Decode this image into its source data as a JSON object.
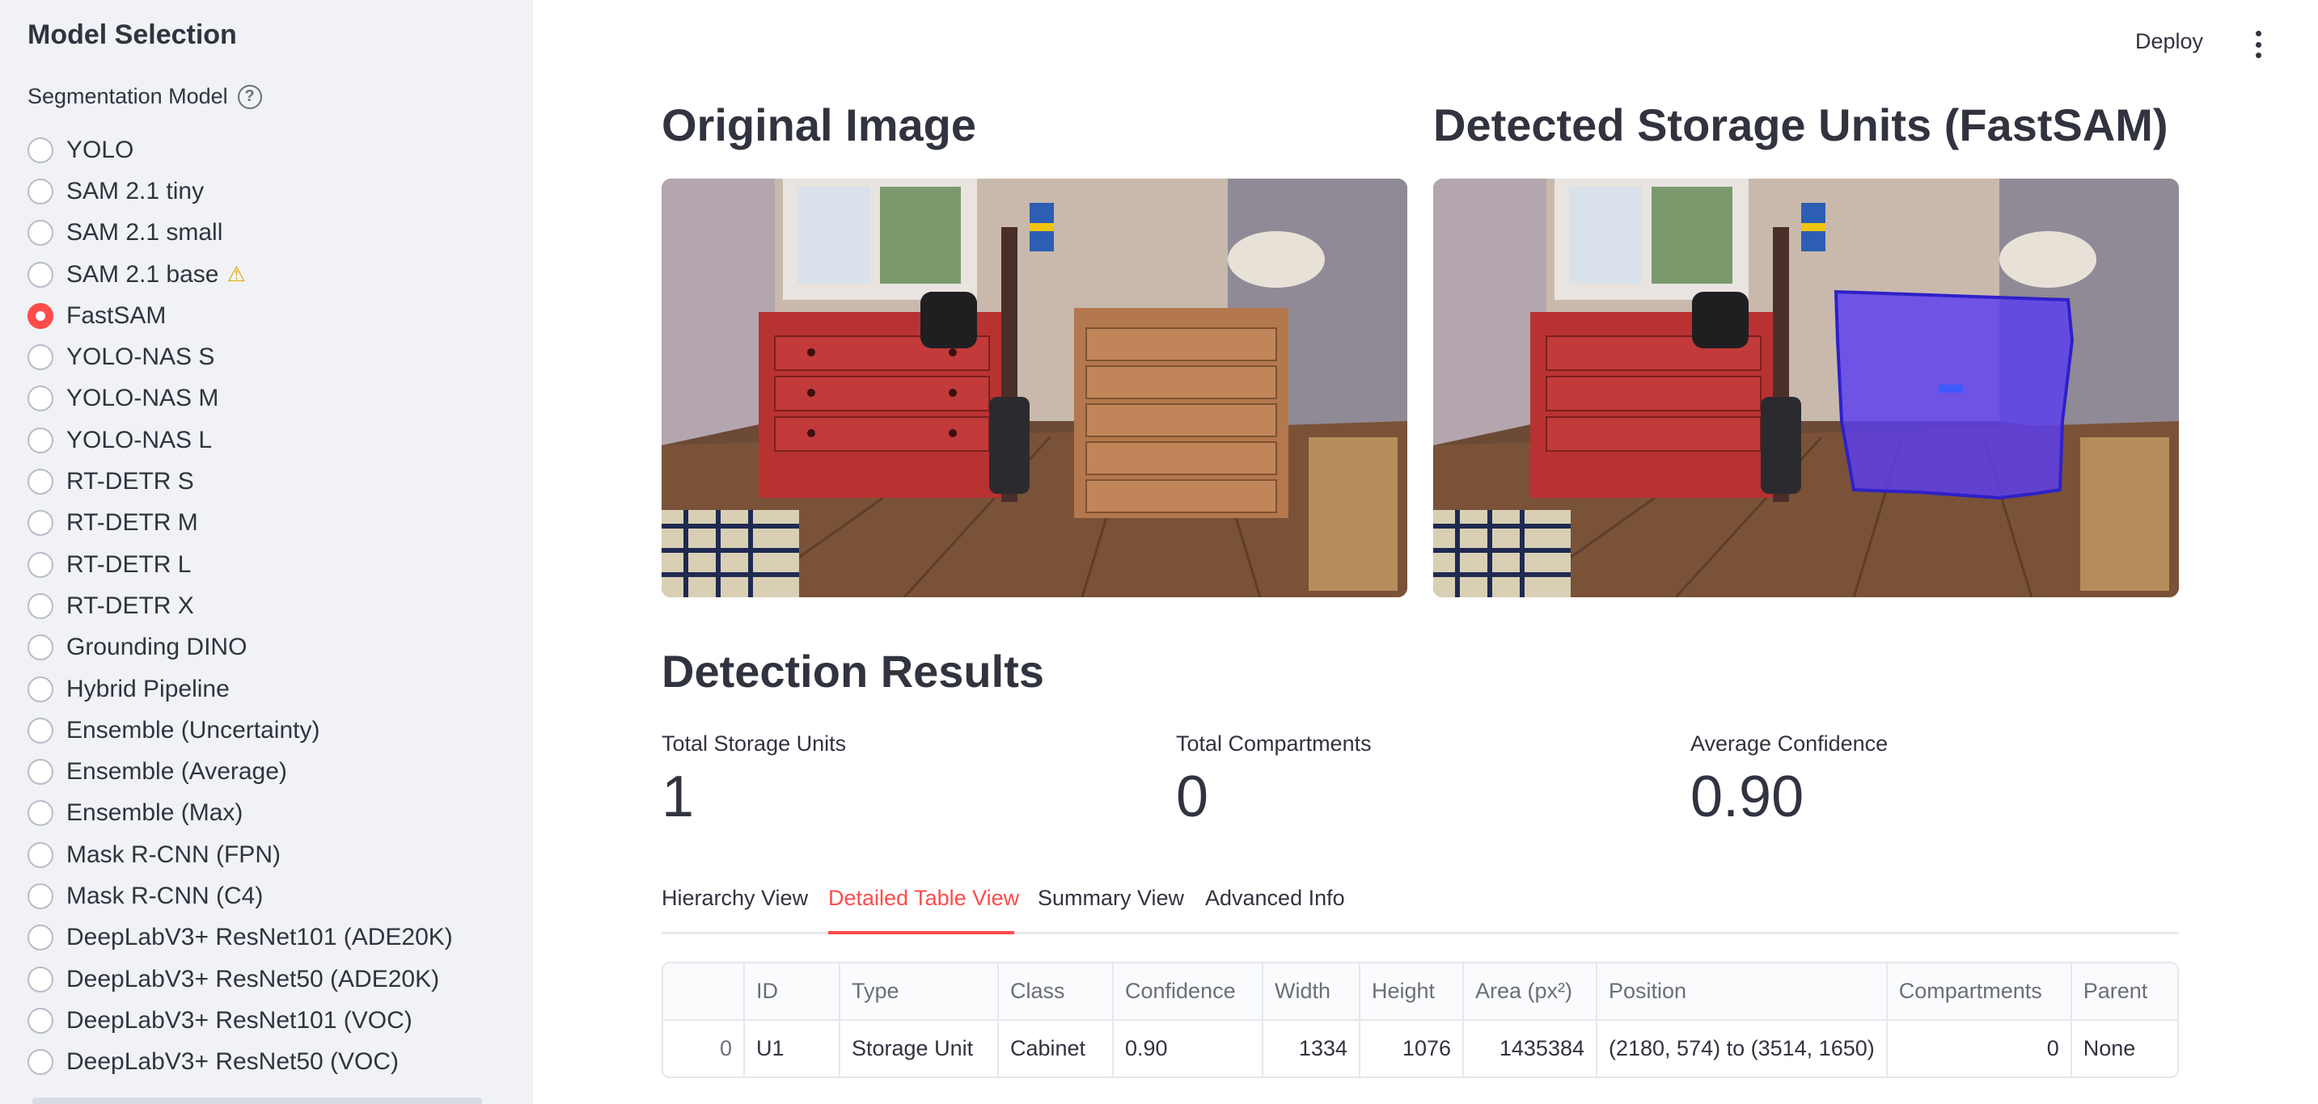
{
  "sidebar": {
    "title": "Model Selection",
    "radio_label": "Segmentation Model",
    "help_icon": "help-circle-icon",
    "options": [
      {
        "label": "YOLO",
        "selected": false
      },
      {
        "label": "SAM 2.1 tiny",
        "selected": false
      },
      {
        "label": "SAM 2.1 small",
        "selected": false
      },
      {
        "label": "SAM 2.1 base",
        "selected": false,
        "icon": "warning-icon"
      },
      {
        "label": "FastSAM",
        "selected": true
      },
      {
        "label": "YOLO-NAS S",
        "selected": false
      },
      {
        "label": "YOLO-NAS M",
        "selected": false
      },
      {
        "label": "YOLO-NAS L",
        "selected": false
      },
      {
        "label": "RT-DETR S",
        "selected": false
      },
      {
        "label": "RT-DETR M",
        "selected": false
      },
      {
        "label": "RT-DETR L",
        "selected": false
      },
      {
        "label": "RT-DETR X",
        "selected": false
      },
      {
        "label": "Grounding DINO",
        "selected": false
      },
      {
        "label": "Hybrid Pipeline",
        "selected": false
      },
      {
        "label": "Ensemble (Uncertainty)",
        "selected": false
      },
      {
        "label": "Ensemble (Average)",
        "selected": false
      },
      {
        "label": "Ensemble (Max)",
        "selected": false
      },
      {
        "label": "Mask R-CNN (FPN)",
        "selected": false
      },
      {
        "label": "Mask R-CNN (C4)",
        "selected": false
      },
      {
        "label": "DeepLabV3+ ResNet101 (ADE20K)",
        "selected": false
      },
      {
        "label": "DeepLabV3+ ResNet50 (ADE20K)",
        "selected": false
      },
      {
        "label": "DeepLabV3+ ResNet101 (VOC)",
        "selected": false
      },
      {
        "label": "DeepLabV3+ ResNet50 (VOC)",
        "selected": false
      }
    ]
  },
  "header": {
    "deploy_label": "Deploy",
    "menu_icon": "more-vertical-icon"
  },
  "images": {
    "original_title": "Original Image",
    "detected_title": "Detected Storage Units (FastSAM)"
  },
  "results": {
    "title": "Detection Results",
    "metrics": [
      {
        "label": "Total Storage Units",
        "value": "1"
      },
      {
        "label": "Total Compartments",
        "value": "0"
      },
      {
        "label": "Average Confidence",
        "value": "0.90"
      }
    ]
  },
  "tabs": [
    {
      "label": "Hierarchy View",
      "active": false
    },
    {
      "label": "Detailed Table View",
      "active": true
    },
    {
      "label": "Summary View",
      "active": false
    },
    {
      "label": "Advanced Info",
      "active": false
    }
  ],
  "table": {
    "headers": [
      "",
      "ID",
      "Type",
      "Class",
      "Confidence",
      "Width",
      "Height",
      "Area (px²)",
      "Position",
      "Compartments",
      "Parent"
    ],
    "rows": [
      [
        "0",
        "U1",
        "Storage Unit",
        "Cabinet",
        "0.90",
        "1334",
        "1076",
        "1435384",
        "(2180, 574) to (3514, 1650)",
        "0",
        "None"
      ]
    ]
  },
  "colors": {
    "accent": "#ff4b4b",
    "sidebar_bg": "#f0f2f6",
    "mask_overlay": "#5a3df0"
  }
}
